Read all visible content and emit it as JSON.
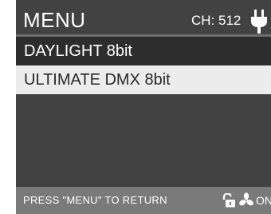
{
  "header": {
    "title": "MENU",
    "channel": "CH: 512",
    "power_icon": "plug-icon"
  },
  "menu": {
    "items": [
      {
        "label": "DAYLIGHT 8bit",
        "selected": false
      },
      {
        "label": "ULTIMATE DMX 8bit",
        "selected": true
      }
    ]
  },
  "footer": {
    "hint": "PRESS \"MENU\" TO RETURN",
    "lock_icon": "unlock-icon",
    "fan_icon": "fan-icon",
    "fan_status": "ON"
  },
  "colors": {
    "screen_bg": "#424242",
    "selected_bg": "#ececec",
    "item_bg": "#2d2d2d",
    "footer_bg": "#7a7a7a"
  }
}
